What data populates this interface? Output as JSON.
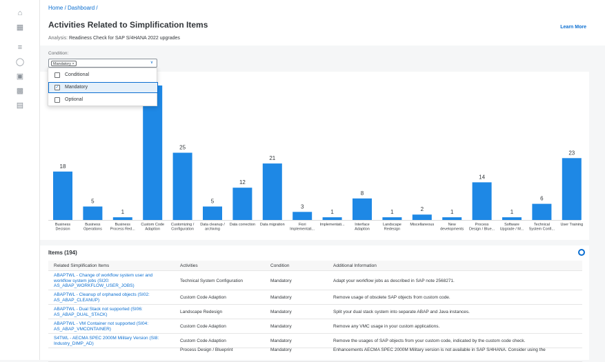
{
  "breadcrumb": "Home / Dashboard /",
  "page_title": "Activities Related to Simplification Items",
  "analysis_label": "Analysis:",
  "analysis_value": "Readiness Check for SAP S/4HANA 2022 upgrades",
  "learn_more": "Learn More",
  "filter": {
    "label": "Condition:",
    "token": "Mandatory ×",
    "options": [
      {
        "label": "Conditional",
        "checked": false
      },
      {
        "label": "Mandatory",
        "checked": true
      },
      {
        "label": "Optional",
        "checked": false
      }
    ]
  },
  "chart_data": {
    "type": "bar",
    "color": "#1e88e5",
    "categories": [
      [
        "Business",
        "Decision"
      ],
      [
        "Business",
        "Operations"
      ],
      [
        "Business",
        "Process Red..."
      ],
      [
        "Custom Code",
        "Adaption"
      ],
      [
        "Customizing /",
        "Configuration"
      ],
      [
        "Data cleanup /",
        "archiving"
      ],
      [
        "Data correction"
      ],
      [
        "Data migration"
      ],
      [
        "Fiori",
        "Implementati..."
      ],
      [
        "Implementati..."
      ],
      [
        "Interface",
        "Adaption"
      ],
      [
        "Landscape",
        "Redesign"
      ],
      [
        "Miscellaneous"
      ],
      [
        "New",
        "developments"
      ],
      [
        "Process",
        "Design / Blue..."
      ],
      [
        "Software",
        "Upgrade / M..."
      ],
      [
        "Technical",
        "System Confi..."
      ],
      [
        "User Training"
      ]
    ],
    "values": [
      18,
      5,
      1,
      50,
      25,
      5,
      12,
      21,
      3,
      1,
      8,
      1,
      2,
      1,
      14,
      1,
      6,
      23
    ],
    "labels": [
      "18",
      "5",
      "1",
      "",
      "25",
      "5",
      "12",
      "21",
      "3",
      "1",
      "8",
      "1",
      "2",
      "1",
      "14",
      "1",
      "6",
      "23"
    ]
  },
  "table": {
    "title": "Items (194)",
    "headers": [
      "Related Simplification Items",
      "Activities",
      "Condition",
      "Additional Information"
    ],
    "rows": [
      {
        "item": [
          "ABAPTWL - Change of workflow system user and",
          "workflow system jobs (SI20:",
          "AS_ABAP_WORKFLOW_USER_JOBS)"
        ],
        "activity": "Technical System Configuration",
        "condition": "Mandatory",
        "info": "Adapt your workflow jobs as described in SAP note 2568271."
      },
      {
        "item": [
          "ABAPTWL - Cleanup of orphaned objects (SI02:",
          "AS_ABAP_CLEANUP)"
        ],
        "activity": "Custom Code Adaption",
        "condition": "Mandatory",
        "info": "Remove usage of obsolete SAP objects from custom code."
      },
      {
        "item": [
          "ABAPTWL - Dual Stack not supported (SI06:",
          "AS_ABAP_DUAL_STACK)"
        ],
        "activity": "Landscape Redesign",
        "condition": "Mandatory",
        "info": "Split your dual stack system into separate ABAP and Java instances."
      },
      {
        "item": [
          "ABAPTWL - VM Container not supported (SI04:",
          "AS_ABAP_VMCONTAINER)"
        ],
        "activity": "Custom Code Adaption",
        "condition": "Mandatory",
        "info": "Remove any VMC usage in your custom applications."
      },
      {
        "item": [
          "S4TWL - AECMA SPEC 2000M Military Version (SI8:",
          "Industry_DIMP_AD)"
        ],
        "activity": "Custom Code Adaption",
        "condition": "Mandatory",
        "info": "Remove the usages of SAP objects from your custom code, indicated by the custom code check."
      },
      {
        "item": [
          ""
        ],
        "activity": "Process Design / Blueprint",
        "condition": "Mandatory",
        "info": "Enhancements AECMA SPEC 2000M Military version is not available in SAP S/4HANA. Consider using the"
      }
    ]
  }
}
